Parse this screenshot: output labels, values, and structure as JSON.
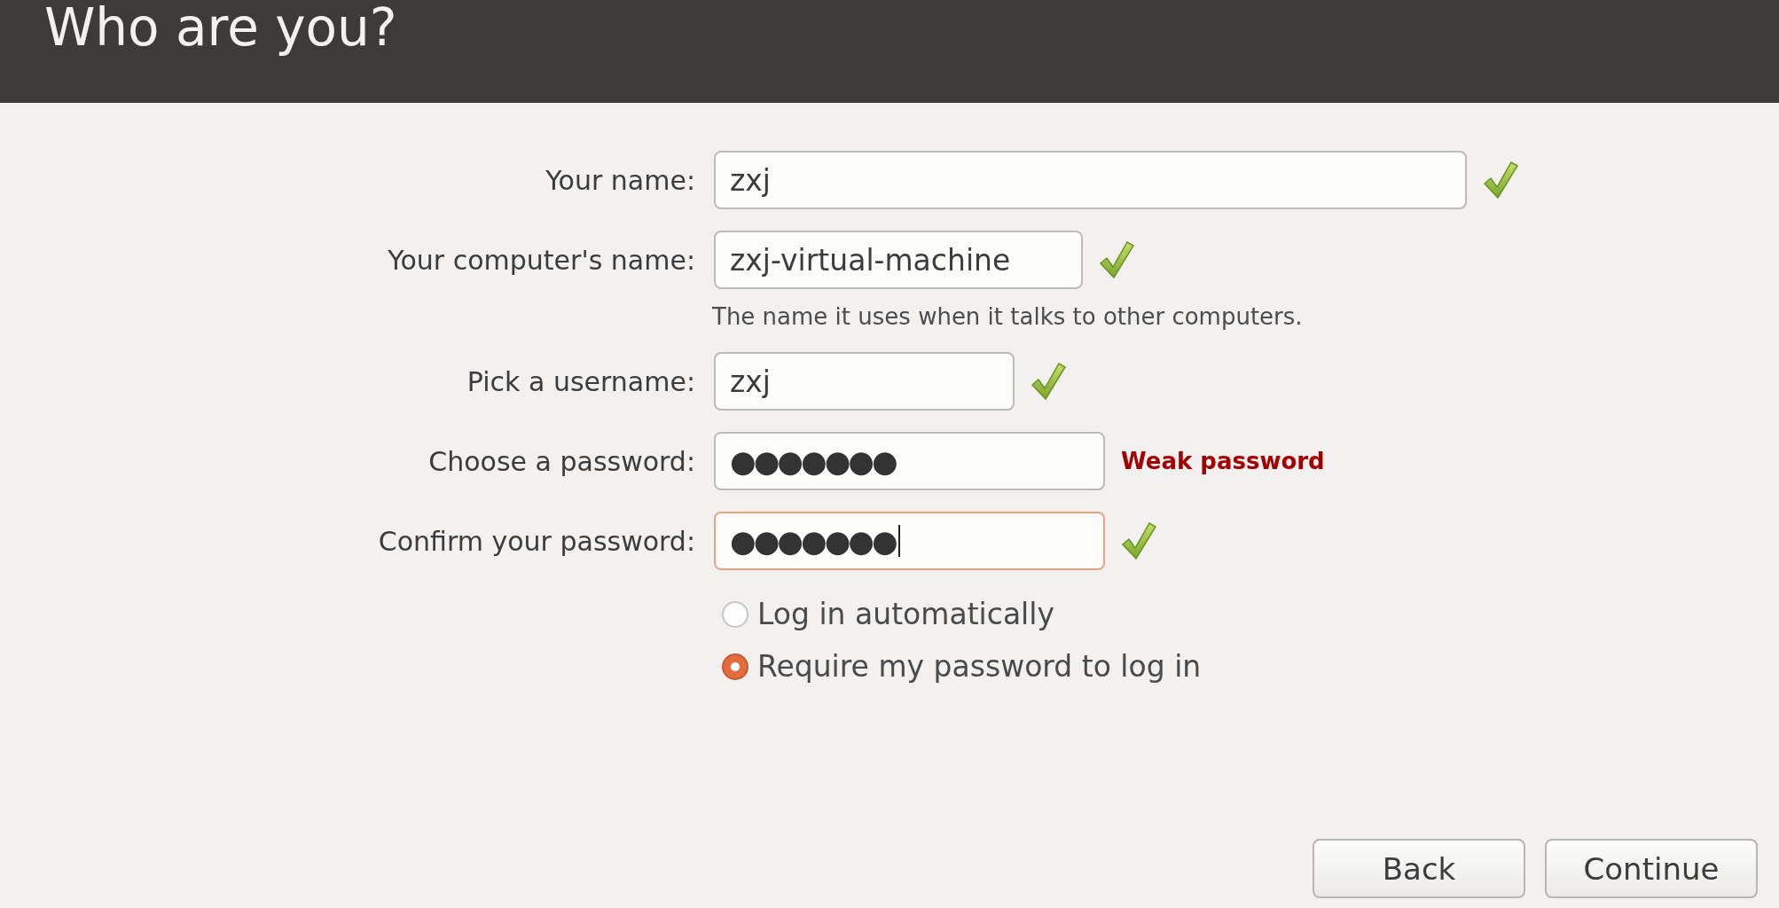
{
  "window": {
    "title": "Who are you?"
  },
  "fields": [
    {
      "label": "Your name:",
      "value": "zxj",
      "kind": "text",
      "ok": true,
      "focused": false
    },
    {
      "label": "Your computer's name:",
      "value": "zxj-virtual-machine",
      "kind": "text",
      "ok": true,
      "focused": false,
      "hint": "The name it uses when it talks to other computers."
    },
    {
      "label": "Pick a username:",
      "value": "zxj",
      "kind": "text",
      "ok": true,
      "focused": false
    },
    {
      "label": "Choose a password:",
      "value": "●●●●●●●",
      "kind": "password",
      "ok": false,
      "focused": false,
      "note": "Weak password"
    },
    {
      "label": "Confirm your password:",
      "value": "●●●●●●●",
      "kind": "password",
      "ok": true,
      "focused": true
    }
  ],
  "login_options": [
    {
      "label": "Log in automatically",
      "selected": false
    },
    {
      "label": "Require my password to log in",
      "selected": true
    }
  ],
  "buttons": [
    {
      "label": "Back"
    },
    {
      "label": "Continue"
    }
  ]
}
